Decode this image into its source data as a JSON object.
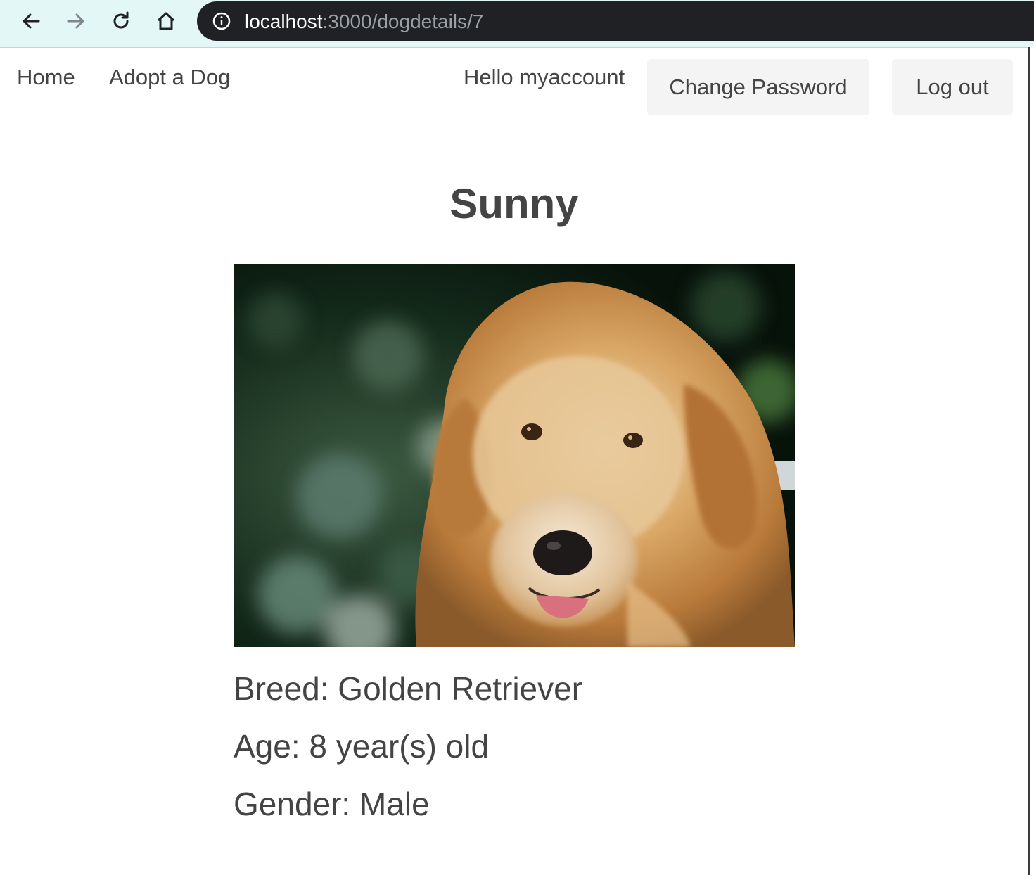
{
  "browser": {
    "url_host": "localhost",
    "url_path": ":3000/dogdetails/7"
  },
  "nav": {
    "home": "Home",
    "adopt": "Adopt a Dog",
    "greeting": "Hello myaccount",
    "change_password": "Change Password",
    "logout": "Log out"
  },
  "dog": {
    "name": "Sunny",
    "breed": "Breed: Golden Retriever",
    "age": "Age: 8 year(s) old",
    "gender": "Gender: Male"
  }
}
